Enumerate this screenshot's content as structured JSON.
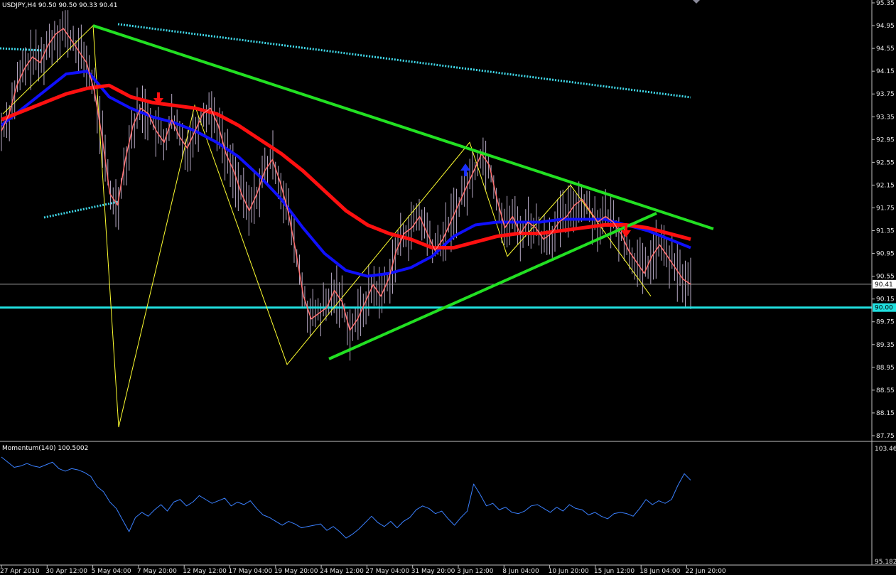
{
  "colors": {
    "background": "#000000",
    "axis": "#c0c0c0",
    "bar": "#d8c8e8",
    "close_line": "#ff7070",
    "ma_red": "#ff1010",
    "ma_blue": "#1010ff",
    "trend_green": "#22e022",
    "dotted_cyan": "#40d8e8",
    "level_cyan": "#20e0e0",
    "zigzag": "#ffff30",
    "momentum": "#3a80ff",
    "arrow_down": "#ff1010",
    "arrow_up": "#1a30ff"
  },
  "chart_data": [
    {
      "type": "line",
      "title": "USDJPY,H4  90.50 90.50 90.33 90.41",
      "symbol": "USDJPY,H4",
      "ohlc_header": "90.50 90.50 90.33 90.41",
      "current_price": 90.41,
      "current_price_label": "90.41",
      "level_line": 90.0,
      "level_label": "90.00",
      "ylim": [
        87.75,
        95.35
      ],
      "y_ticks": [
        "95.35",
        "94.95",
        "94.55",
        "94.15",
        "93.75",
        "93.35",
        "92.95",
        "92.55",
        "92.15",
        "91.75",
        "91.35",
        "90.95",
        "90.55",
        "90.15",
        "89.75",
        "89.35",
        "88.95",
        "88.55",
        "88.15",
        "87.75"
      ],
      "x_tick_labels": [
        "27 Apr 2010",
        "30 Apr 12:00",
        "5 May 04:00",
        "7 May 20:00",
        "12 May 12:00",
        "17 May 04:00",
        "19 May 20:00",
        "24 May 12:00",
        "27 May 04:00",
        "31 May 20:00",
        "3 Jun 12:00",
        "8 Jun 04:00",
        "10 Jun 20:00",
        "15 Jun 12:00",
        "18 Jun 04:00",
        "22 Jun 20:00"
      ],
      "close_series": [
        93.1,
        93.4,
        93.9,
        94.2,
        94.4,
        94.3,
        94.6,
        94.8,
        94.9,
        94.7,
        94.5,
        94.3,
        93.8,
        93.0,
        92.0,
        91.8,
        92.6,
        93.2,
        93.5,
        93.4,
        93.1,
        92.9,
        93.3,
        93.0,
        92.8,
        93.1,
        93.4,
        93.5,
        93.2,
        92.7,
        92.4,
        92.0,
        91.7,
        92.0,
        92.4,
        92.6,
        92.2,
        91.7,
        91.0,
        90.2,
        89.8,
        89.9,
        90.0,
        90.3,
        90.1,
        89.6,
        89.8,
        90.1,
        90.4,
        90.2,
        90.5,
        91.0,
        91.3,
        91.4,
        91.6,
        91.3,
        91.0,
        91.2,
        91.5,
        91.8,
        92.1,
        92.4,
        92.7,
        92.5,
        91.9,
        91.4,
        91.6,
        91.3,
        91.5,
        91.4,
        91.2,
        91.3,
        91.5,
        91.6,
        91.8,
        91.9,
        91.7,
        91.5,
        91.6,
        91.5,
        91.3,
        91.0,
        90.8,
        90.6,
        90.9,
        91.1,
        90.9,
        90.7,
        90.5,
        90.41
      ],
      "ma_red": [
        93.3,
        93.45,
        93.6,
        93.75,
        93.85,
        93.9,
        93.7,
        93.6,
        93.55,
        93.5,
        93.4,
        93.2,
        92.95,
        92.7,
        92.4,
        92.05,
        91.7,
        91.45,
        91.3,
        91.2,
        91.05,
        91.05,
        91.15,
        91.25,
        91.3,
        91.3,
        91.35,
        91.4,
        91.45,
        91.45,
        91.4,
        91.3,
        91.2
      ],
      "ma_blue": [
        93.2,
        93.5,
        93.8,
        94.1,
        94.15,
        93.7,
        93.5,
        93.35,
        93.25,
        93.1,
        92.9,
        92.65,
        92.3,
        91.9,
        91.4,
        90.95,
        90.65,
        90.55,
        90.6,
        90.7,
        90.9,
        91.25,
        91.45,
        91.5,
        91.5,
        91.5,
        91.55,
        91.55,
        91.55,
        91.45,
        91.35,
        91.2,
        91.05
      ],
      "trend_lines": [
        {
          "from": [
            "28 Apr",
            94.95
          ],
          "to": [
            "24 Jun",
            91.35
          ]
        },
        {
          "from": [
            "23 May",
            89.15
          ],
          "to": [
            "17 Jun",
            91.65
          ]
        }
      ],
      "annotations": {
        "arrows": [
          {
            "direction": "down",
            "at": "7 May",
            "price": 93.75,
            "color": "#ff1010"
          },
          {
            "direction": "up",
            "at": "3 Jun",
            "price": 92.35,
            "color": "#1a30ff"
          },
          {
            "direction": "down",
            "at": "16 Jun",
            "price": 91.2,
            "color": "#ff1010"
          }
        ]
      },
      "grid": false
    },
    {
      "type": "line",
      "title": "Momentum(140) 100.5002",
      "indicator": "Momentum(140)",
      "value_label": "100.5002",
      "ylim": [
        95.182,
        103.465
      ],
      "y_tick_top": "103.465",
      "y_tick_bottom": "95.182",
      "values": [
        103.3,
        102.9,
        102.5,
        102.6,
        102.8,
        102.6,
        102.5,
        102.7,
        102.9,
        102.4,
        102.2,
        102.4,
        102.3,
        102.1,
        101.8,
        101.0,
        100.6,
        99.8,
        99.3,
        98.4,
        97.5,
        98.6,
        99.0,
        98.7,
        99.2,
        99.6,
        99.1,
        99.8,
        100.0,
        99.5,
        99.8,
        100.3,
        100.0,
        99.7,
        99.9,
        100.1,
        99.5,
        99.8,
        99.6,
        99.9,
        99.3,
        98.8,
        98.6,
        98.3,
        98.0,
        98.3,
        98.1,
        97.8,
        97.9,
        98.0,
        98.1,
        97.6,
        97.9,
        97.5,
        97.0,
        97.3,
        97.7,
        98.2,
        98.7,
        98.2,
        97.9,
        98.3,
        97.8,
        98.3,
        98.6,
        99.2,
        99.5,
        99.3,
        98.9,
        99.1,
        98.5,
        98.0,
        98.6,
        99.1,
        101.2,
        100.4,
        99.5,
        99.7,
        99.2,
        99.4,
        99.0,
        98.9,
        99.1,
        99.5,
        99.6,
        99.3,
        99.0,
        99.4,
        99.1,
        99.6,
        99.3,
        99.2,
        98.8,
        99.0,
        98.7,
        98.5,
        98.9,
        99.0,
        98.9,
        98.7,
        99.3,
        100.0,
        99.6,
        99.9,
        99.7,
        100.0,
        101.1,
        102.0,
        101.5
      ]
    }
  ]
}
